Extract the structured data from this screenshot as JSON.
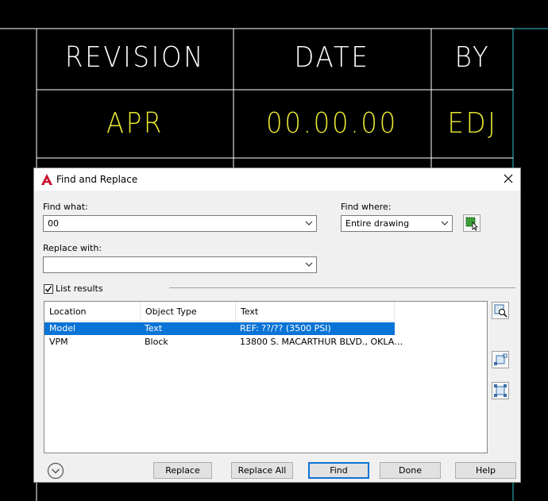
{
  "cad": {
    "headers": [
      "REVISION",
      "DATE",
      "BY"
    ],
    "values": [
      "APR",
      "00.00.00",
      "EDJ"
    ]
  },
  "dialog": {
    "title": "Find and Replace",
    "find_what_label": "Find what:",
    "find_what_value": "00",
    "find_where_label": "Find where:",
    "find_where_value": "Entire drawing",
    "replace_with_label": "Replace with:",
    "replace_with_value": "",
    "list_results_label": "List results",
    "list_results_checked": true,
    "columns": [
      "Location",
      "Object Type",
      "Text"
    ],
    "rows": [
      {
        "location": "Model",
        "object_type": "Text",
        "text": "REF: ??/?? (3500 PSI)",
        "selected": true
      },
      {
        "location": "VPM",
        "object_type": "Block",
        "text": "13800 S. MACARTHUR BLVD., OKLA…",
        "selected": false
      }
    ],
    "buttons": {
      "replace": "Replace",
      "replace_all": "Replace All",
      "find": "Find",
      "done": "Done",
      "help": "Help"
    }
  },
  "colors": {
    "selection": "#0a74d6",
    "cad_value": "#e8e832",
    "cad_line": "#2fc4d0"
  }
}
